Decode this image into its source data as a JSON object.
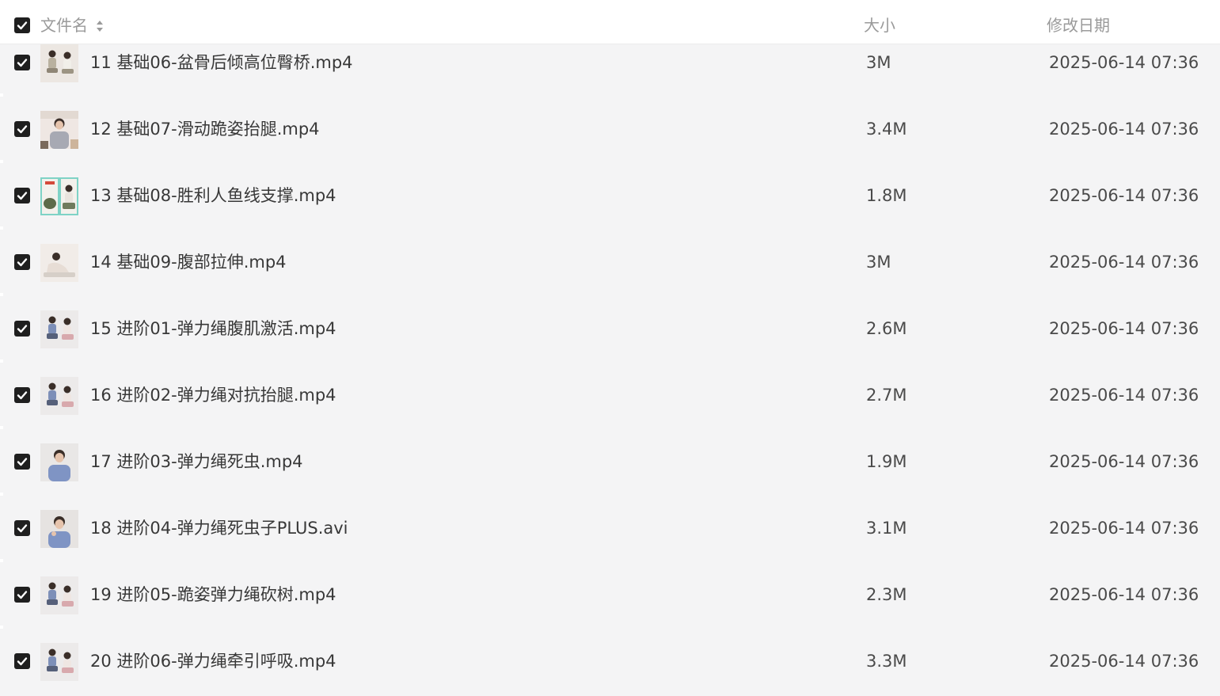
{
  "header": {
    "name_label": "文件名",
    "size_label": "大小",
    "date_label": "修改日期"
  },
  "files": [
    {
      "name": "11 基础06-盆骨后倾高位臀桥.mp4",
      "size": "3M",
      "modified": "2025-06-14 07:36"
    },
    {
      "name": "12 基础07-滑动跪姿抬腿.mp4",
      "size": "3.4M",
      "modified": "2025-06-14 07:36"
    },
    {
      "name": "13 基础08-胜利人鱼线支撑.mp4",
      "size": "1.8M",
      "modified": "2025-06-14 07:36"
    },
    {
      "name": "14 基础09-腹部拉伸.mp4",
      "size": "3M",
      "modified": "2025-06-14 07:36"
    },
    {
      "name": "15 进阶01-弹力绳腹肌激活.mp4",
      "size": "2.6M",
      "modified": "2025-06-14 07:36"
    },
    {
      "name": "16 进阶02-弹力绳对抗抬腿.mp4",
      "size": "2.7M",
      "modified": "2025-06-14 07:36"
    },
    {
      "name": "17 进阶03-弹力绳死虫.mp4",
      "size": "1.9M",
      "modified": "2025-06-14 07:36"
    },
    {
      "name": "18 进阶04-弹力绳死虫子PLUS.avi",
      "size": "3.1M",
      "modified": "2025-06-14 07:36"
    },
    {
      "name": "19 进阶05-跪姿弹力绳砍树.mp4",
      "size": "2.3M",
      "modified": "2025-06-14 07:36"
    },
    {
      "name": "20 进阶06-弹力绳牵引呼吸.mp4",
      "size": "3.3M",
      "modified": "2025-06-14 07:36"
    }
  ],
  "colors": {
    "checkbox": "#1f1f1f",
    "row_bg": "#f4f4f5",
    "header_bg": "#ffffff",
    "header_text": "#9a9a9a"
  }
}
